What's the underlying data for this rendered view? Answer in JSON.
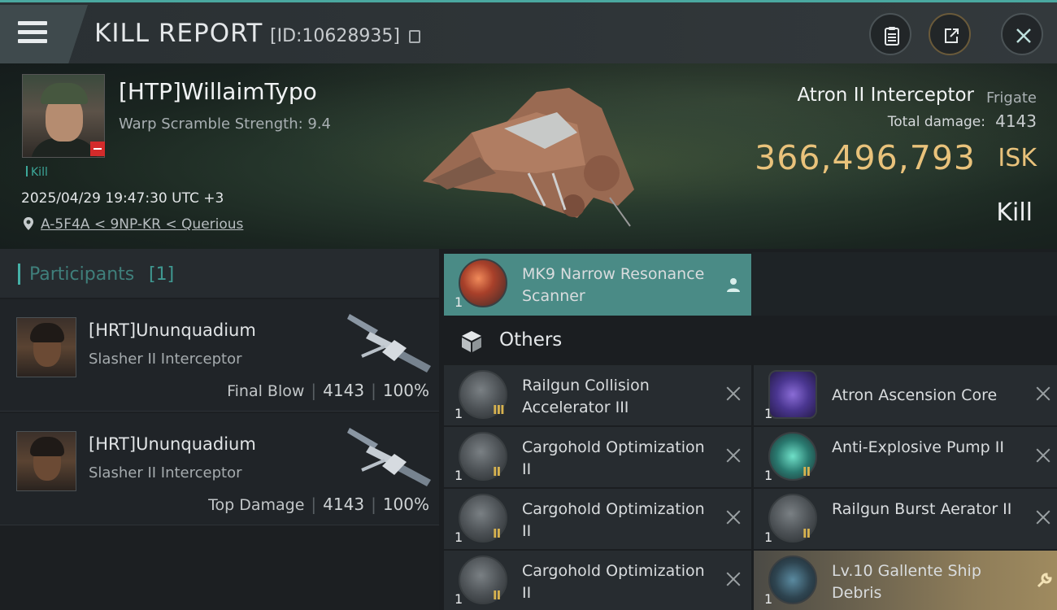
{
  "header": {
    "title": "KILL REPORT",
    "report_id": "[ID:10628935]",
    "icons": [
      "menu-icon",
      "copy-icon",
      "clipboard-icon",
      "share-icon",
      "close-icon"
    ]
  },
  "victim": {
    "name": "[HTP]WillaimTypo",
    "warp_scramble": "Warp Scramble Strength: 9.4",
    "kill_tag": "Kill",
    "datetime": "2025/04/29 19:47:30 UTC +3",
    "location": "A-5F4A < 9NP-KR < Querious",
    "ship_type": "Atron II Interceptor",
    "ship_class": "Frigate",
    "total_damage_label": "Total damage:",
    "total_damage": "4143",
    "isk_value": "366,496,793",
    "isk_unit": "ISK",
    "result": "Kill"
  },
  "participants": {
    "title": "Participants",
    "count": "[1]",
    "list": [
      {
        "name": "[HRT]Ununquadium",
        "ship": "Slasher II Interceptor",
        "label": "Final Blow",
        "damage": "4143",
        "percent": "100%"
      },
      {
        "name": "[HRT]Ununquadium",
        "ship": "Slasher II Interceptor",
        "label": "Top Damage",
        "damage": "4143",
        "percent": "100%"
      }
    ]
  },
  "items": {
    "highlight": {
      "qty": "1",
      "name": "MK9 Narrow Resonance Scanner"
    },
    "others_label": "Others",
    "left": [
      {
        "qty": "1",
        "tier": "III",
        "name": "Railgun Collision Accelerator III"
      },
      {
        "qty": "1",
        "tier": "II",
        "name": "Cargohold Optimization II"
      },
      {
        "qty": "1",
        "tier": "II",
        "name": "Cargohold Optimization II"
      },
      {
        "qty": "1",
        "tier": "II",
        "name": "Cargohold Optimization II"
      }
    ],
    "right": [
      {
        "qty": "1",
        "tier": "",
        "name": "Atron Ascension Core"
      },
      {
        "qty": "1",
        "tier": "II",
        "name": "Anti-Explosive Pump II"
      },
      {
        "qty": "1",
        "tier": "II",
        "name": "Railgun Burst Aerator II"
      },
      {
        "qty": "1",
        "tier": "",
        "name": "Lv.10 Gallente Ship Debris"
      }
    ]
  },
  "colors": {
    "accent": "#45b1a7",
    "isk": "#e9c27b",
    "highlight": "#4a8b86",
    "destroyed": "#d32b2b"
  }
}
